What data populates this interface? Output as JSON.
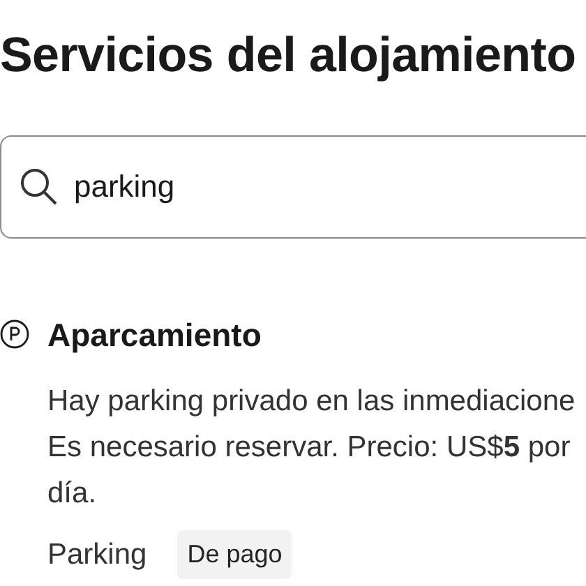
{
  "title": "Servicios del alojamiento",
  "search": {
    "value": "parking"
  },
  "facility": {
    "name": "Aparcamiento",
    "description_lines": [
      "Hay parking privado en las inmediacione",
      "Es necesario reservar. Precio: US$**5** por",
      "día."
    ],
    "items": [
      {
        "label": "Parking",
        "badge": "De pago"
      }
    ]
  }
}
